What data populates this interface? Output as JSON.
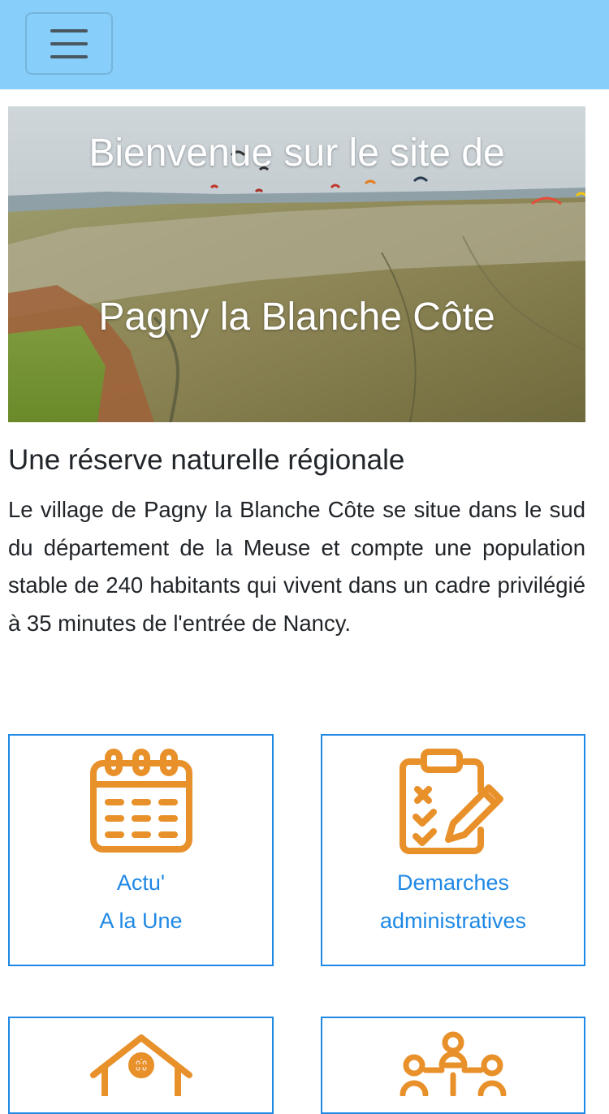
{
  "navbar": {
    "background": "#87cefa",
    "menu_icon": "hamburger-menu-icon"
  },
  "hero": {
    "line1": "Bienvenue sur le site de",
    "line2": "Pagny la Blanche Côte",
    "image": "aerial-valley-photo"
  },
  "section": {
    "title": "Une réserve naturelle régionale",
    "text": "Le village de Pagny la Blanche Côte se situe dans le sud du département de la Meuse et compte une population stable de 240 habitants qui vivent dans un cadre privilégié à 35 minutes de l'entrée de Nancy."
  },
  "cards": [
    {
      "icon": "calendar-icon",
      "line1": "Actu'",
      "line2": "A la Une"
    },
    {
      "icon": "clipboard-checklist-icon",
      "line1": "Demarches",
      "line2": "administratives"
    },
    {
      "icon": "house-icon"
    },
    {
      "icon": "people-network-icon"
    }
  ],
  "colors": {
    "accent": "#1e88e5",
    "icon": "#e8912b"
  }
}
